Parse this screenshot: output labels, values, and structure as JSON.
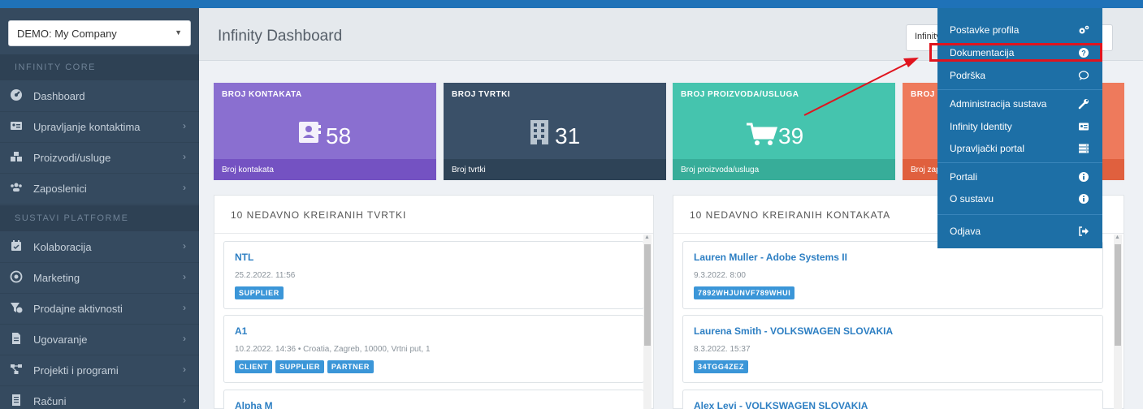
{
  "sidebar": {
    "company": "DEMO: My Company",
    "section_core": "INFINITY CORE",
    "section_platform": "SUSTAVI PLATFORME",
    "items": [
      {
        "label": "Dashboard"
      },
      {
        "label": "Upravljanje kontaktima"
      },
      {
        "label": "Proizvodi/usluge"
      },
      {
        "label": "Zaposlenici"
      },
      {
        "label": "Kolaboracija"
      },
      {
        "label": "Marketing"
      },
      {
        "label": "Prodajne aktivnosti"
      },
      {
        "label": "Ugovaranje"
      },
      {
        "label": "Projekti i programi"
      },
      {
        "label": "Računi"
      }
    ]
  },
  "header": {
    "title": "Infinity Dashboard",
    "button_label": "Infinity"
  },
  "stats": [
    {
      "title": "BROJ KONTAKATA",
      "value": "58",
      "footer": "Broj kontakata",
      "color": "#7f5fc4"
    },
    {
      "title": "BROJ TVRTKI",
      "value": "31",
      "footer": "Broj tvrtki",
      "color": "#334b61"
    },
    {
      "title": "BROJ PROIZVODA/USLUGA",
      "value": "39",
      "footer": "Broj proizvoda/usluga",
      "color": "#3ebca7"
    },
    {
      "title": "BROJ Z",
      "value": "",
      "footer": "Broj zap",
      "color": "#e9684a"
    }
  ],
  "companies_panel": {
    "title": "10 NEDAVNO KREIRANIH TVRTKI",
    "cards": [
      {
        "name": "NTL",
        "meta": "25.2.2022. 11:56",
        "tags": [
          "SUPPLIER"
        ]
      },
      {
        "name": "A1",
        "meta": "10.2.2022. 14:36  •  Croatia, Zagreb, 10000, Vrtni put, 1",
        "tags": [
          "CLIENT",
          "SUPPLIER",
          "PARTNER"
        ]
      },
      {
        "name": "Alpha M",
        "meta": "",
        "tags": []
      }
    ]
  },
  "contacts_panel": {
    "title": "10 NEDAVNO KREIRANIH KONTAKATA",
    "cards": [
      {
        "name": "Lauren Muller - Adobe Systems II",
        "meta": "9.3.2022. 8:00",
        "tags": [
          "7892WHJUNVF789WHUI"
        ]
      },
      {
        "name": "Laurena Smith - VOLKSWAGEN SLOVAKIA",
        "meta": "8.3.2022. 15:37",
        "tags": [
          "34TGG4ZEZ"
        ]
      },
      {
        "name": "Alex Levi - VOLKSWAGEN SLOVAKIA",
        "meta": "",
        "tags": []
      }
    ]
  },
  "dropdown": {
    "items": [
      {
        "label": "Postavke profila",
        "icon": "gears-icon"
      },
      {
        "label": "Dokumentacija",
        "icon": "question-circle-icon"
      },
      {
        "label": "Podrška",
        "icon": "chat-bubble-icon"
      },
      {
        "label": "Administracija sustava",
        "icon": "wrench-icon"
      },
      {
        "label": "Infinity Identity",
        "icon": "id-card-icon"
      },
      {
        "label": "Upravljački portal",
        "icon": "server-icon"
      },
      {
        "label": "Portali",
        "icon": "info-circle-icon"
      },
      {
        "label": "O sustavu",
        "icon": "info-circle-icon"
      },
      {
        "label": "Odjava",
        "icon": "sign-out-icon"
      }
    ]
  },
  "colors": {
    "accent_blue": "#1f72b8",
    "dropdown_bg": "#1d6fa6",
    "highlight_red": "#e0141e",
    "link_blue": "#2d7fc3"
  }
}
